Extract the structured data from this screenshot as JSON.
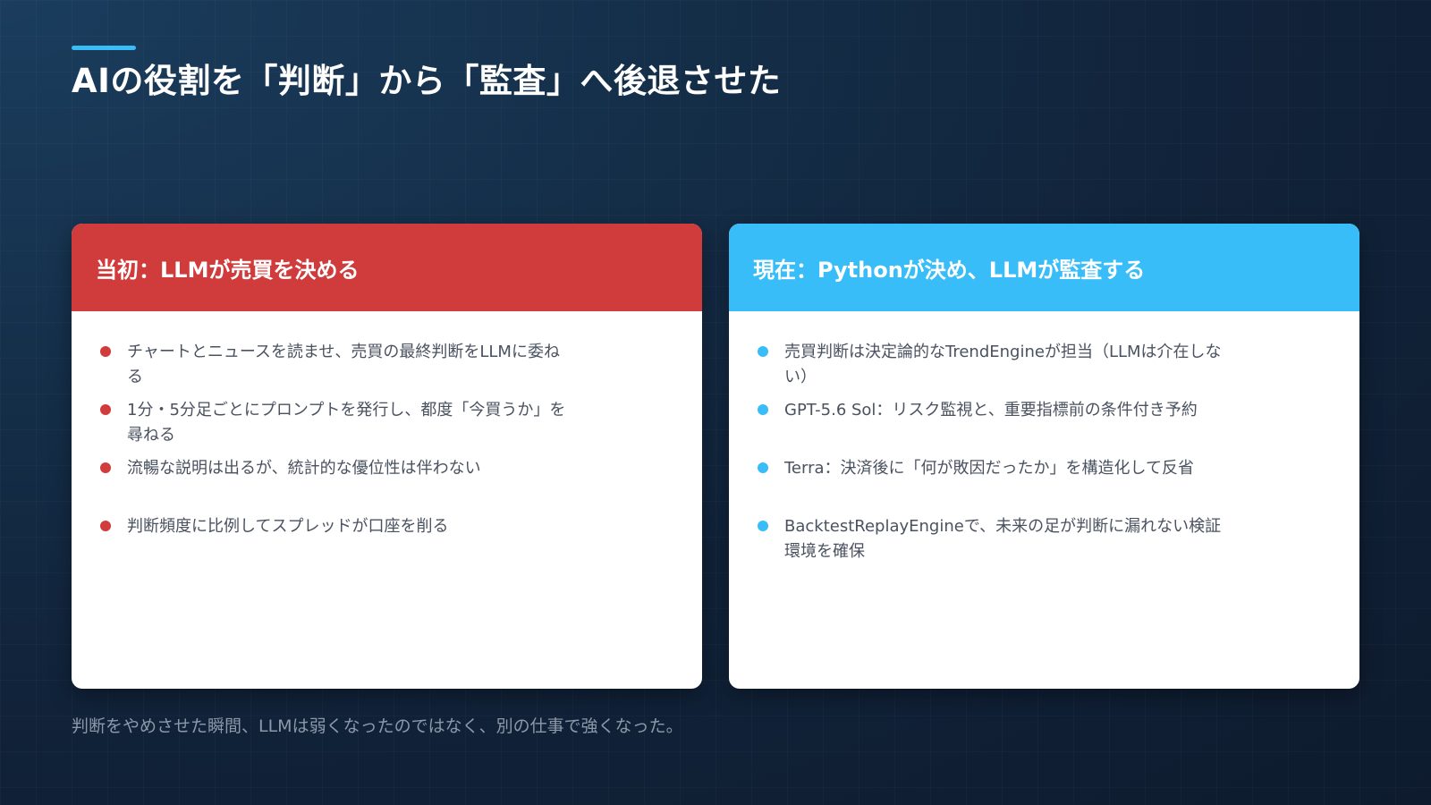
{
  "title": "AIの役割を「判断」から「監査」へ後退させた",
  "colors": {
    "accent": "#38bdf8",
    "before": "#d03b3b",
    "after": "#38bdf8",
    "background": "#11233a"
  },
  "cards": [
    {
      "title": "当初：LLMが売買を決める",
      "items": [
        "チャートとニュースを読ませ、売買の最終判断をLLMに委ねる",
        "1分・5分足ごとにプロンプトを発行し、都度「今買うか」を尋ねる",
        "流暢な説明は出るが、統計的な優位性は伴わない",
        "判断頻度に比例してスプレッドが口座を削る"
      ]
    },
    {
      "title": "現在：Pythonが決め、LLMが監査する",
      "items": [
        "売買判断は決定論的なTrendEngineが担当（LLMは介在しない）",
        "GPT-5.6 Sol：リスク監視と、重要指標前の条件付き予約",
        "Terra：決済後に「何が敗因だったか」を構造化して反省",
        "BacktestReplayEngineで、未来の足が判断に漏れない検証環境を確保"
      ]
    }
  ],
  "footer": "判断をやめさせた瞬間、LLMは弱くなったのではなく、別の仕事で強くなった。"
}
